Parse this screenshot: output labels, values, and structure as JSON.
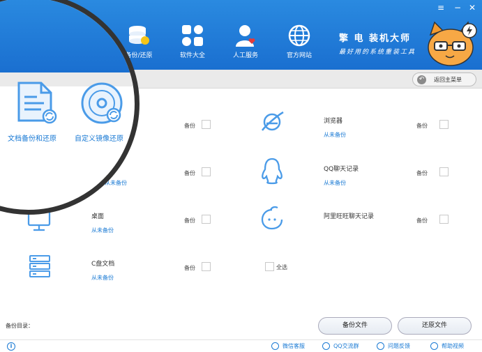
{
  "window_controls": {
    "menu": "≡",
    "minimize": "−",
    "close": "✕"
  },
  "nav": [
    {
      "label": "备份/还原",
      "icon": "database-icon"
    },
    {
      "label": "软件大全",
      "icon": "apps-grid-icon"
    },
    {
      "label": "人工服务",
      "icon": "user-support-icon"
    },
    {
      "label": "官方网站",
      "icon": "globe-icon"
    }
  ],
  "brand": {
    "title": "擎 电 装机大师",
    "slogan": "最好用的系统重装工具"
  },
  "return_button": {
    "label": "返回主菜单"
  },
  "items": [
    {
      "title": "",
      "status": "",
      "backup": "备份"
    },
    {
      "title": "浏览器",
      "status": "从未备份",
      "backup": "备份",
      "icon": "browser-icon"
    },
    {
      "title": "",
      "status": "从未备份",
      "backup": "备份"
    },
    {
      "title": "QQ聊天记录",
      "status": "从未备份",
      "backup": "备份",
      "icon": "qq-icon"
    },
    {
      "title": "桌面",
      "status": "从未备份",
      "backup": "备份",
      "icon": "desktop-icon"
    },
    {
      "title": "阿里旺旺聊天记录",
      "status": "",
      "backup": "备份",
      "icon": "wangwang-icon"
    },
    {
      "title": "C盘文档",
      "status": "从未备份",
      "backup": "备份",
      "icon": "server-icon"
    }
  ],
  "select_all": "全选",
  "footer": {
    "backup_dir_label": "备份目录：",
    "backup_files_button": "备份文件",
    "restore_files_button": "还原文件"
  },
  "statusbar": [
    {
      "label": "微信客服",
      "icon": "wechat-icon"
    },
    {
      "label": "QQ交流群",
      "icon": "qq-group-icon"
    },
    {
      "label": "问题反馈",
      "icon": "feedback-icon"
    },
    {
      "label": "帮助视频",
      "icon": "help-icon"
    }
  ],
  "magnifier": {
    "doc_backup_label": "文档备份和还原",
    "custom_image_label": "自定义镜像还原"
  },
  "colors": {
    "header": "#1a6fd0",
    "accent": "#1a7ad4",
    "icon_blue": "#4a9be8"
  }
}
